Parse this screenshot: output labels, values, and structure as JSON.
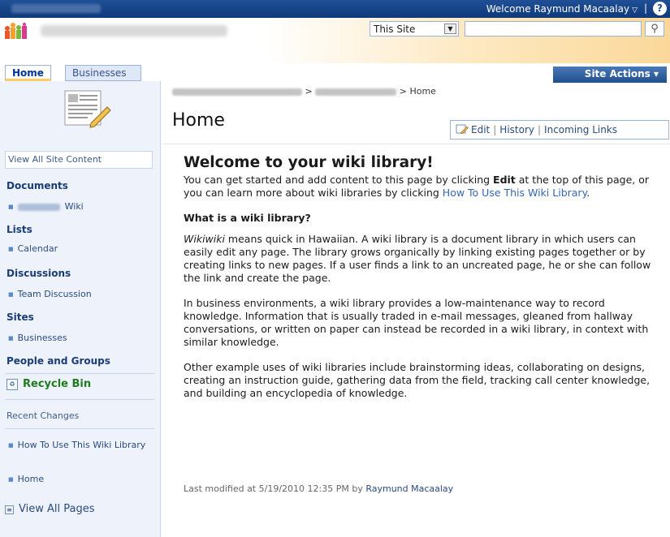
{
  "topbar": {
    "welcome": "Welcome Raymund Macaalay",
    "separator": "|",
    "help_glyph": "?"
  },
  "header": {
    "scope_select": "This Site",
    "search_placeholder": "",
    "search_button_icon": "search-icon"
  },
  "tabs": [
    {
      "label": "Home"
    },
    {
      "label": "Businesses"
    }
  ],
  "site_actions": "Site Actions ▾",
  "breadcrumb": {
    "separator_1": ">",
    "separator_2": ">",
    "current": "Home"
  },
  "page": {
    "title": "Home",
    "toolbar": {
      "edit": "Edit",
      "history": "History",
      "incoming": "Incoming Links"
    }
  },
  "nav": {
    "view_all": "View All Site Content",
    "documents_head": "Documents",
    "documents_items": [
      "Wiki"
    ],
    "lists_head": "Lists",
    "lists_items": [
      "Calendar"
    ],
    "discussions_head": "Discussions",
    "discussions_items": [
      "Team Discussion"
    ],
    "sites_head": "Sites",
    "sites_items": [
      "Businesses"
    ],
    "people_head": "People and Groups",
    "recycle": "Recycle Bin",
    "recent_head": "Recent Changes",
    "recent_items": [
      "How To Use This Wiki Library",
      "Home"
    ],
    "view_all_pages": "View All Pages"
  },
  "wiki": {
    "heading": "Welcome to your wiki library!",
    "intro_1": "You can get started and add content to this page by clicking ",
    "intro_edit": "Edit",
    "intro_2": " at the top of this page, or you can learn more about wiki libraries by clicking ",
    "intro_link": "How To Use This Wiki Library",
    "intro_3": ".",
    "subheading": "What is a wiki library?",
    "p1_em": "Wikiwiki",
    "p1_rest": " means quick in Hawaiian. A wiki library is a document library in which users can easily edit any page. The library grows organically by linking existing pages together or by creating links to new pages. If a user finds a link to an uncreated page, he or she can follow the link and create the page.",
    "p2": "In business environments, a wiki library provides a low-maintenance way to record knowledge. Information that is usually traded in e-mail messages, gleaned from hallway conversations, or written on paper can instead be recorded in a wiki library, in context with similar knowledge.",
    "p3": "Other example uses of wiki libraries include brainstorming ideas, collaborating on designs, creating an instruction guide, gathering data from the field, tracking call center knowledge, and building an encyclopedia of knowledge.",
    "last_modified_prefix": "Last modified at 5/19/2010 12:35 PM  by ",
    "last_modified_by": "Raymund Macaalay"
  }
}
